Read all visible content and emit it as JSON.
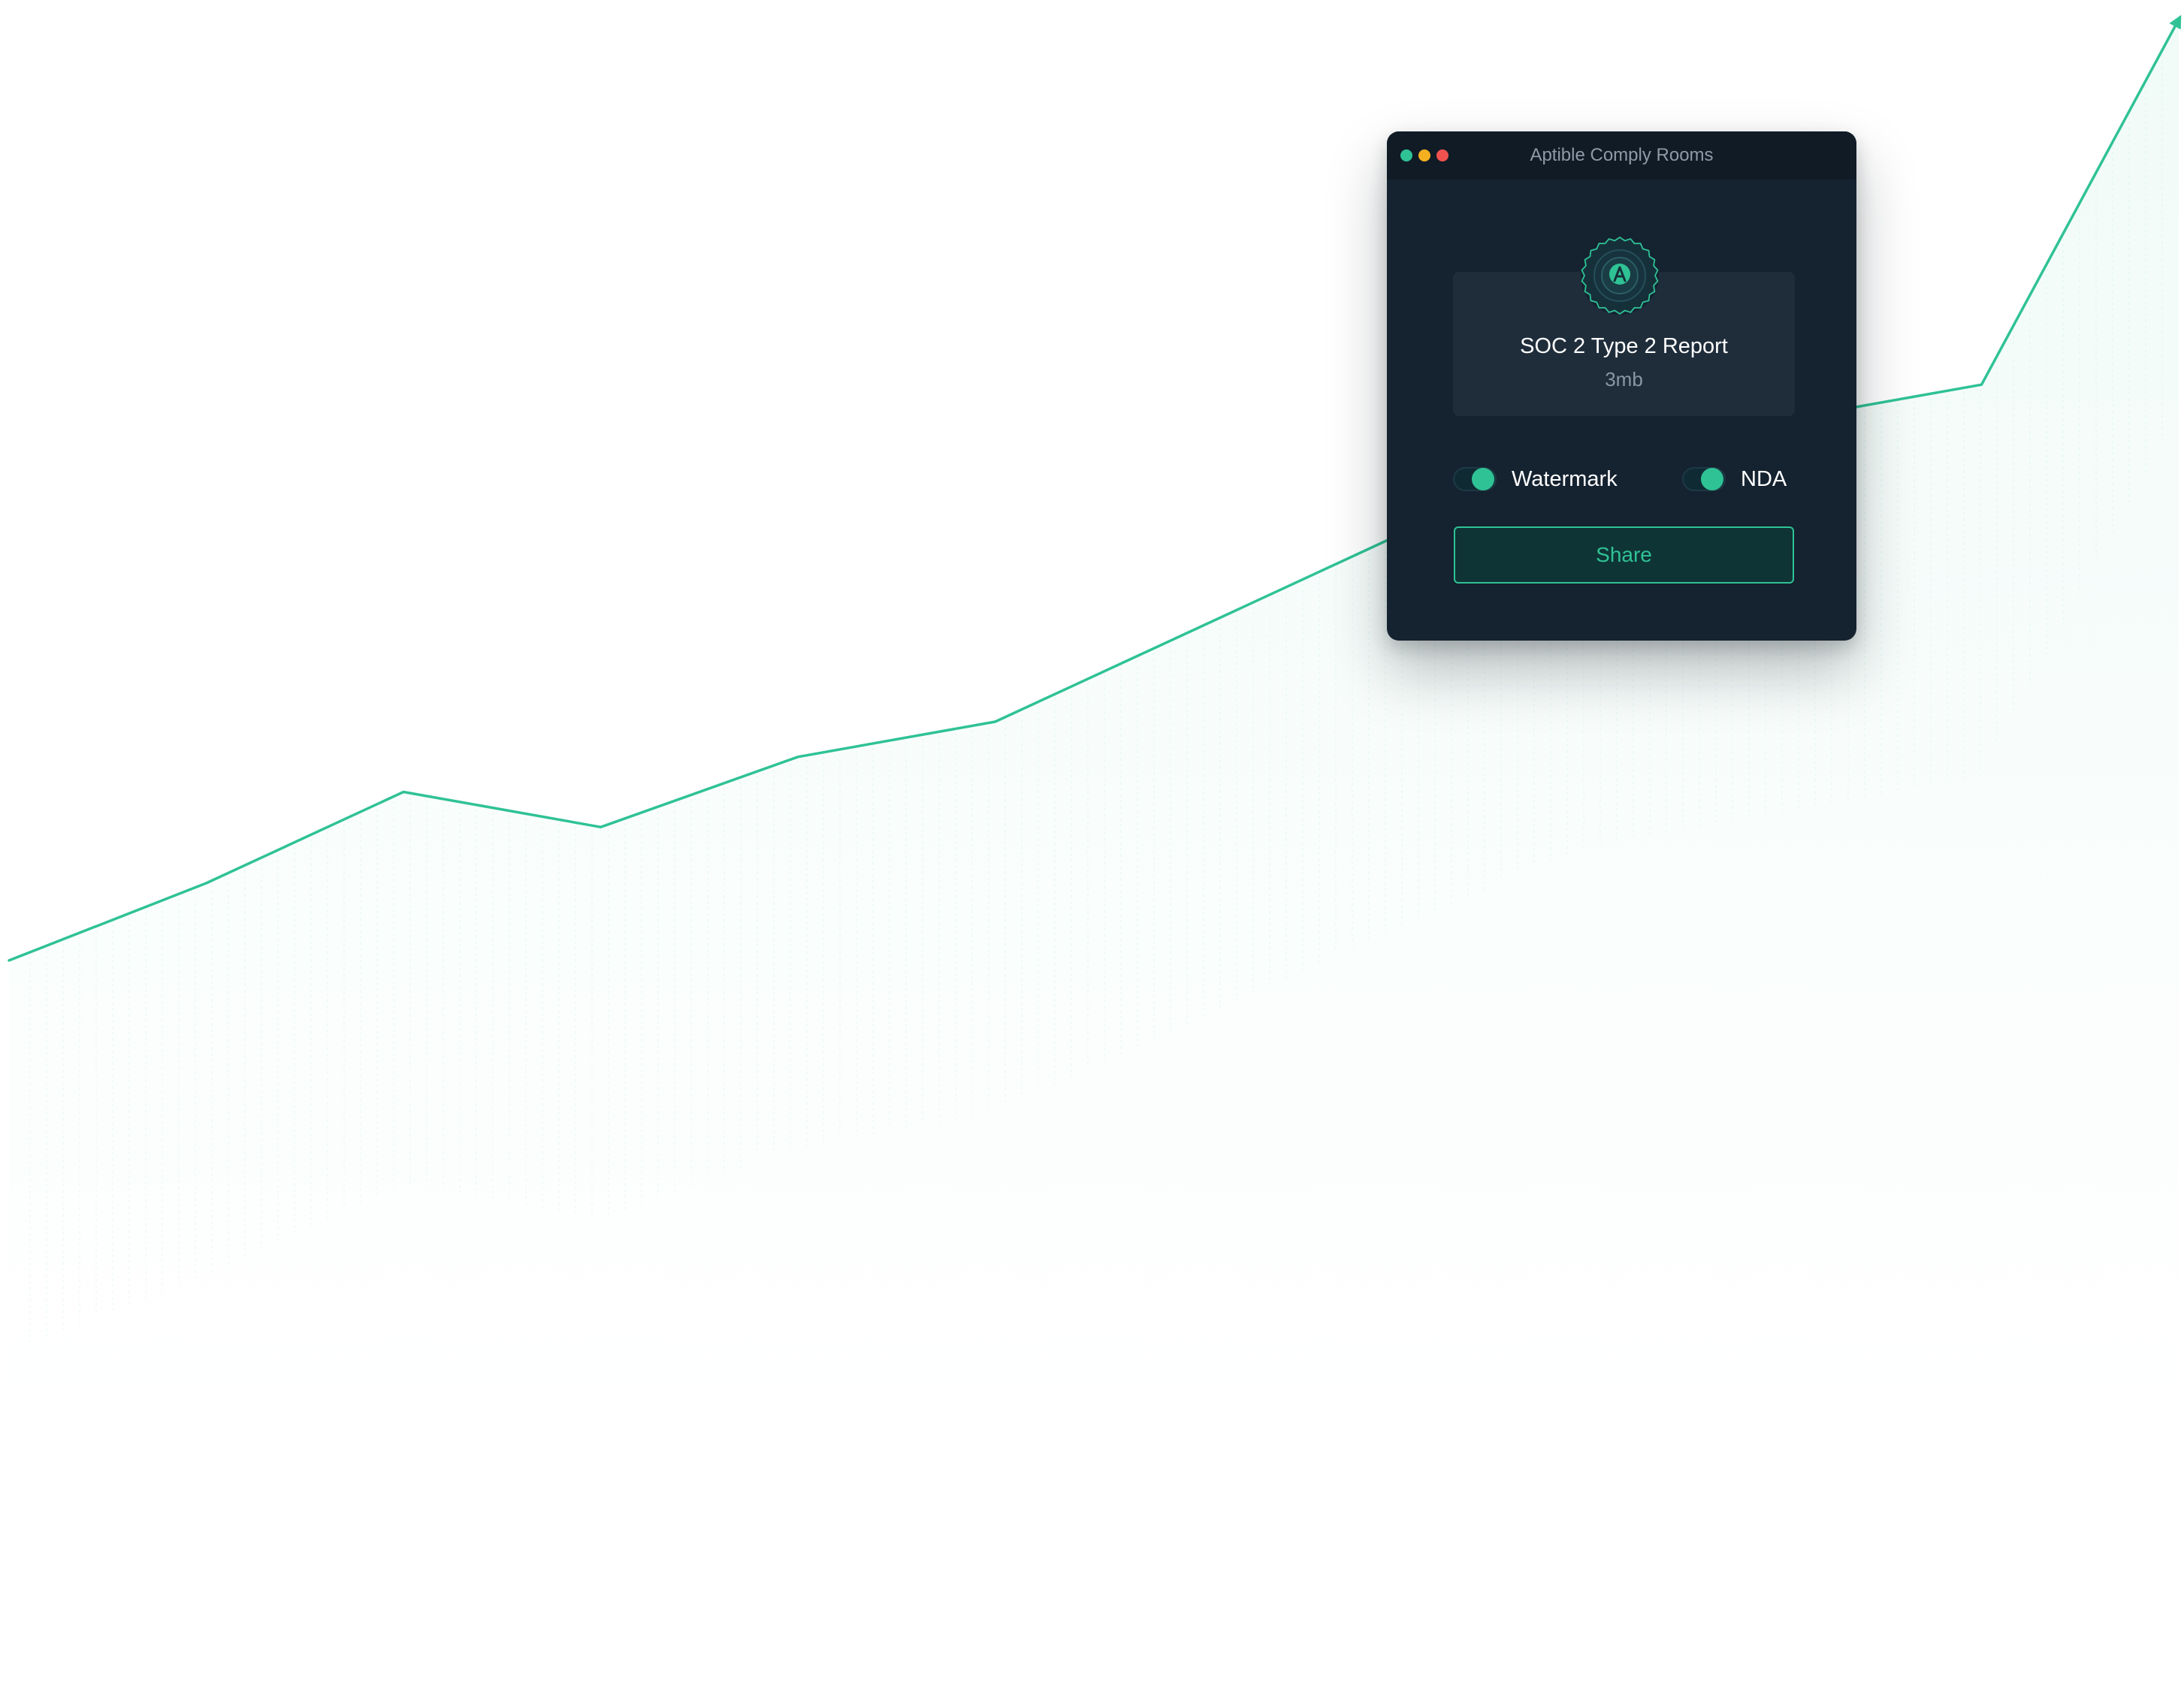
{
  "window": {
    "title": "Aptible Comply Rooms",
    "traffic_lights": [
      "#2fc295",
      "#f5b020",
      "#f0524f"
    ]
  },
  "file": {
    "icon": "seal-badge-icon",
    "name": "SOC 2 Type 2 Report",
    "size": "3mb"
  },
  "toggles": [
    {
      "label": "Watermark",
      "on": true
    },
    {
      "label": "NDA",
      "on": true
    }
  ],
  "share_button": {
    "label": "Share"
  },
  "colors": {
    "accent": "#2fc295",
    "window_bg": "#152230",
    "titlebar_bg": "#101b26",
    "card_bg": "#1f2d3b"
  },
  "chart_data": {
    "type": "area",
    "title": "",
    "xlabel": "",
    "ylabel": "",
    "x": [
      0,
      1,
      2,
      3,
      4,
      5,
      6,
      7,
      8,
      9,
      10,
      11
    ],
    "series": [
      {
        "values": [
          6,
          17,
          30,
          25,
          35,
          40,
          53,
          66,
          78,
          83,
          88,
          140
        ]
      }
    ],
    "ylim": [
      0,
      140
    ],
    "grid": false,
    "legend": "none"
  }
}
